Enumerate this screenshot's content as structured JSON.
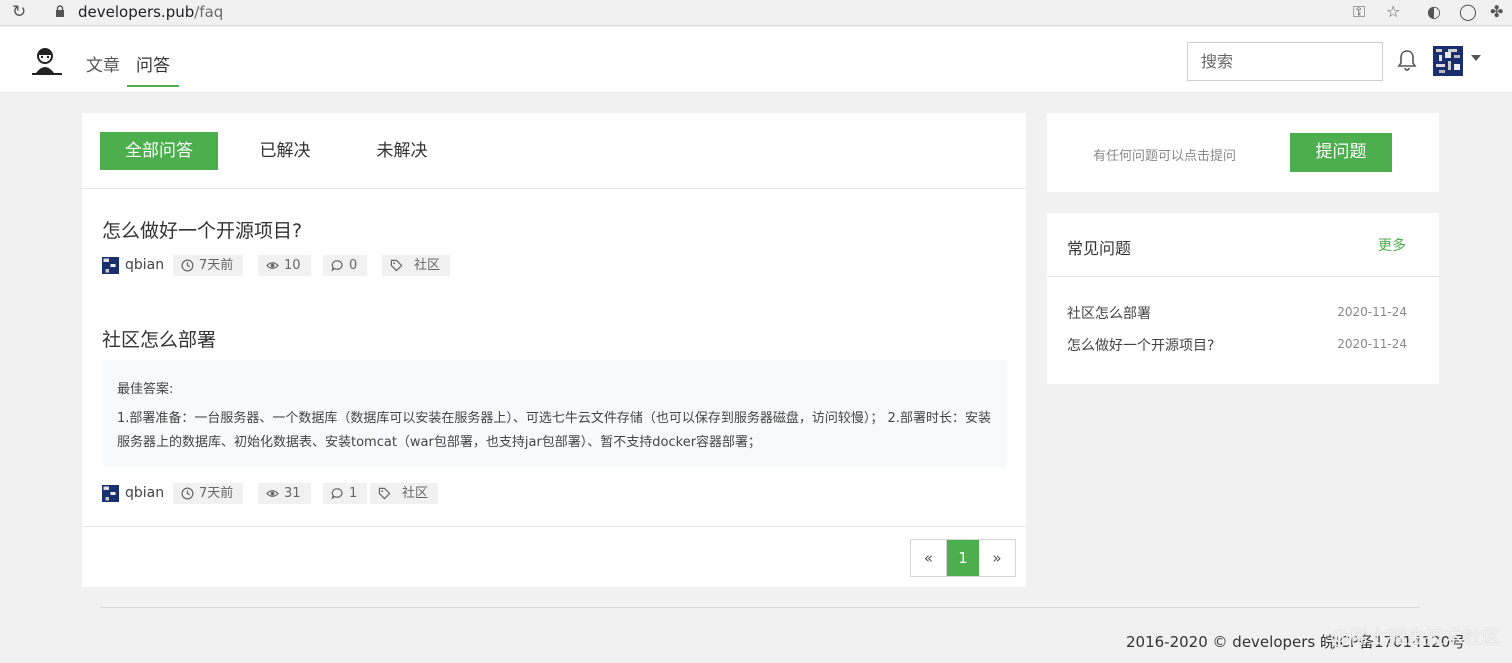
{
  "browser": {
    "url_host": "developers.pub",
    "url_path": "/faq"
  },
  "header": {
    "nav": [
      "文章",
      "问答"
    ],
    "search_placeholder": "搜索"
  },
  "tabs": [
    "全部问答",
    "已解决",
    "未解决"
  ],
  "questions": [
    {
      "title": "怎么做好一个开源项目?",
      "user": "qbian",
      "time": "7天前",
      "views": "10",
      "comments": "0",
      "tag": "社区"
    },
    {
      "title": "社区怎么部署",
      "answer_label": "最佳答案:",
      "answer_text": "1.部署准备：一台服务器、一个数据库（数据库可以安装在服务器上）、可选七牛云文件存储（也可以保存到服务器磁盘，访问较慢）； 2.部署时长：安装服务器上的数据库、初始化数据表、安装tomcat（war包部署，也支持jar包部署）、暂不支持docker容器部署；",
      "user": "qbian",
      "time": "7天前",
      "views": "31",
      "comments": "1",
      "tag": "社区"
    }
  ],
  "pagination": {
    "prev": "«",
    "current": "1",
    "next": "»"
  },
  "ask": {
    "hint": "有任何问题可以点击提问",
    "button": "提问题"
  },
  "faq": {
    "title": "常见问题",
    "more": "更多",
    "items": [
      {
        "title": "社区怎么部署",
        "date": "2020-11-24"
      },
      {
        "title": "怎么做好一个开源项目?",
        "date": "2020-11-24"
      }
    ]
  },
  "footer": {
    "text": "2016-2020 © developers 皖ICP备17014120号",
    "watermark": "@稀土掘金技术社区"
  },
  "colors": {
    "accent": "#4cae4c",
    "page_bg": "#f1f1f1"
  }
}
